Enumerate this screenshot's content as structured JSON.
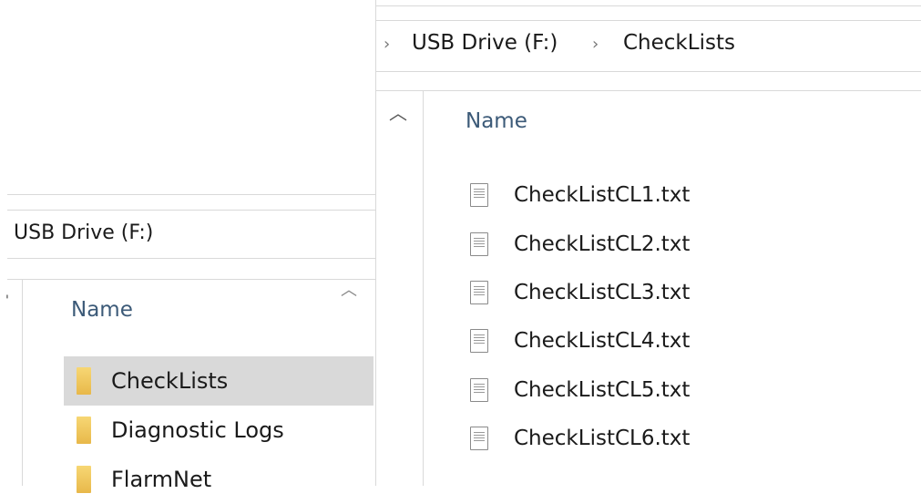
{
  "left": {
    "breadcrumb": "USB Drive (F:)",
    "column_header": "Name",
    "collapse_icon": "chevron-up-icon",
    "items": [
      {
        "label": "CheckLists",
        "selected": true
      },
      {
        "label": "Diagnostic Logs",
        "selected": false
      },
      {
        "label": "FlarmNet",
        "selected": false
      }
    ]
  },
  "right": {
    "breadcrumb": [
      "USB Drive (F:)",
      "CheckLists"
    ],
    "separator": "›",
    "column_header": "Name",
    "up_icon": "chevron-up-icon",
    "files": [
      "CheckListCL1.txt",
      "CheckListCL2.txt",
      "CheckListCL3.txt",
      "CheckListCL4.txt",
      "CheckListCL5.txt",
      "CheckListCL6.txt"
    ]
  },
  "colors": {
    "selected_bg": "#d9d9d9",
    "folder": "#f0c85a",
    "header_text": "#3c5a78"
  }
}
